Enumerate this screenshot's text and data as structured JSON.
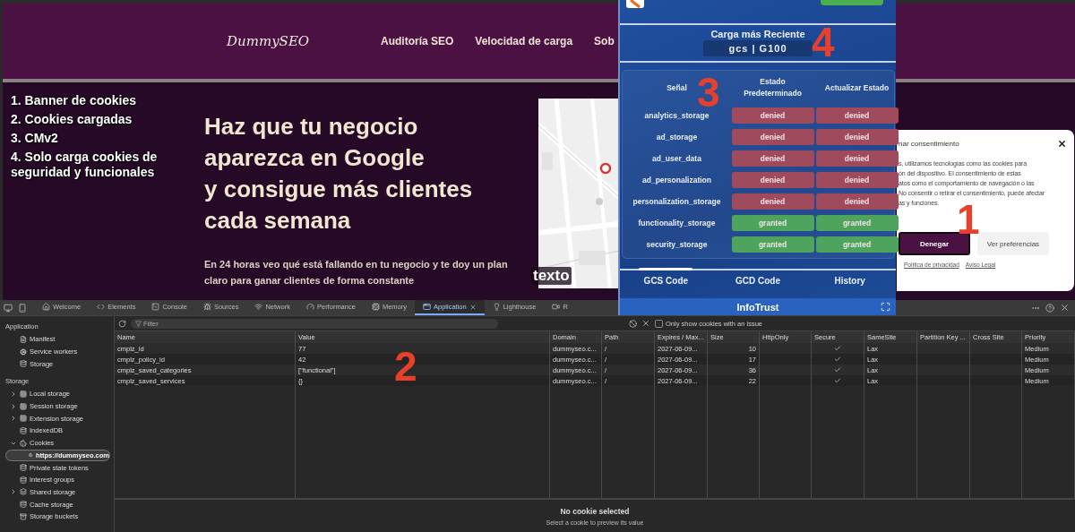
{
  "website": {
    "logo": "DummySEO",
    "nav": [
      "Auditoría SEO",
      "Velocidad de carga",
      "Sob"
    ],
    "annotations": [
      "1. Banner de cookies",
      "2. Cookies cargadas",
      "3. CMv2",
      "4. Solo carga cookies de seguridad y funcionales"
    ],
    "headline": [
      "Haz que tu negocio",
      "aparezca en Google",
      "y consigue más clientes",
      "cada semana"
    ],
    "paragraph": "En 24 horas veo qué está fallando en tu negocio y te doy un plan claro para ganar clientes de forma constante",
    "map": {
      "kind": "picture",
      "caption": "texto"
    }
  },
  "cookie_banner": {
    "title": "nar consentimiento",
    "body_lines": [
      "s, utilizamos tecnologías como las cookies para",
      "ón del dispositivo. El consentimiento de estas",
      "atos como el comportamiento de navegación o las",
      "No consentir o retirar el consentimiento, puede afectar",
      "as y funciones."
    ],
    "buttons": [
      {
        "label": "Denegar",
        "kind": "primary"
      },
      {
        "label": "Ver preferencias",
        "kind": "secondary"
      }
    ],
    "links": [
      "Política de privacidad",
      "Aviso Legal"
    ]
  },
  "markers": [
    "1",
    "2",
    "3",
    "4"
  ],
  "consent_popup": {
    "latest_load_title": "Carga más Reciente",
    "latest_load_value": "gcs | G100",
    "columns": [
      "Señal",
      "Estado Predeterminado",
      "Actualizar Estado"
    ],
    "signals": [
      {
        "name": "analytics_storage",
        "default": {
          "label": "denied",
          "granted": false
        },
        "update": {
          "label": "denied",
          "granted": false
        }
      },
      {
        "name": "ad_storage",
        "default": {
          "label": "denied",
          "granted": false
        },
        "update": {
          "label": "denied",
          "granted": false
        }
      },
      {
        "name": "ad_user_data",
        "default": {
          "label": "denied",
          "granted": false
        },
        "update": {
          "label": "denied",
          "granted": false
        }
      },
      {
        "name": "ad_personalization",
        "default": {
          "label": "denied",
          "granted": false
        },
        "update": {
          "label": "denied",
          "granted": false
        }
      },
      {
        "name": "personalization_storage",
        "default": {
          "label": "denied",
          "granted": false
        },
        "update": {
          "label": "denied",
          "granted": false
        }
      },
      {
        "name": "functionality_storage",
        "default": {
          "label": "granted",
          "granted": true
        },
        "update": {
          "label": "granted",
          "granted": true
        }
      },
      {
        "name": "security_storage",
        "default": {
          "label": "granted",
          "granted": true
        },
        "update": {
          "label": "granted",
          "granted": true
        }
      }
    ],
    "tabs": [
      {
        "label": "GCS Code",
        "selected": true
      },
      {
        "label": "GCD Code",
        "selected": false
      },
      {
        "label": "History",
        "selected": false
      }
    ],
    "footer": "InfoTrust"
  },
  "devtools": {
    "tabs": [
      {
        "label": "Welcome",
        "selected": false
      },
      {
        "label": "Elements",
        "selected": false
      },
      {
        "label": "Console",
        "selected": false
      },
      {
        "label": "Sources",
        "selected": false
      },
      {
        "label": "Network",
        "selected": false
      },
      {
        "label": "Performance",
        "selected": false
      },
      {
        "label": "Memory",
        "selected": false
      },
      {
        "label": "Application",
        "selected": true
      },
      {
        "label": "Lighthouse",
        "selected": false
      },
      {
        "label": "R",
        "selected": false
      }
    ],
    "sidebar": [
      {
        "title": "Application",
        "items": [
          {
            "label": "Manifest",
            "selected": false
          },
          {
            "label": "Service workers",
            "selected": false
          },
          {
            "label": "Storage",
            "selected": false
          }
        ]
      },
      {
        "title": "Storage",
        "items": [
          {
            "label": "Local storage",
            "selected": false,
            "expanded": false
          },
          {
            "label": "Session storage",
            "selected": false,
            "expanded": false
          },
          {
            "label": "Extension storage",
            "selected": false,
            "expanded": false
          },
          {
            "label": "IndexedDB",
            "selected": false
          },
          {
            "label": "Cookies",
            "selected": false,
            "expanded": true,
            "children": [
              {
                "label": "https://dummyseo.com",
                "selected": true
              }
            ]
          },
          {
            "label": "Private state tokens",
            "selected": false
          },
          {
            "label": "Interest groups",
            "selected": false
          },
          {
            "label": "Shared storage",
            "selected": false,
            "expanded": false
          },
          {
            "label": "Cache storage",
            "selected": false
          },
          {
            "label": "Storage buckets",
            "selected": false
          }
        ]
      }
    ],
    "filter": {
      "placeholder": "Filter"
    },
    "issue_checkbox": {
      "label": "Only show cookies with an issue",
      "checked": false
    },
    "columns": [
      "Name",
      "Value",
      "Domain",
      "Path",
      "Expires / Max...",
      "Size",
      "HttpOnly",
      "Secure",
      "SameSite",
      "Partition Key ...",
      "Cross Site",
      "Priority"
    ],
    "rows": [
      {
        "name": "cmplz_id",
        "value": "77",
        "domain": "dummyseo.c...",
        "path": "/",
        "expires": "2027-06-09...",
        "size": "10",
        "http_only": false,
        "secure": true,
        "same_site": "Lax",
        "priority": "Medium"
      },
      {
        "name": "cmplz_policy_id",
        "value": "42",
        "domain": "dummyseo.c...",
        "path": "/",
        "expires": "2027-06-09...",
        "size": "17",
        "http_only": false,
        "secure": true,
        "same_site": "Lax",
        "priority": "Medium"
      },
      {
        "name": "cmplz_saved_categories",
        "value": "[\"functional\"]",
        "domain": "dummyseo.c...",
        "path": "/",
        "expires": "2027-06-09...",
        "size": "36",
        "http_only": false,
        "secure": true,
        "same_site": "Lax",
        "priority": "Medium"
      },
      {
        "name": "cmplz_saved_services",
        "value": "{}",
        "domain": "dummyseo.c...",
        "path": "/",
        "expires": "2027-06-09...",
        "size": "22",
        "http_only": false,
        "secure": true,
        "same_site": "Lax",
        "priority": "Medium"
      }
    ],
    "preview": {
      "title": "No cookie selected",
      "hint": "Select a cookie to preview its value"
    }
  }
}
